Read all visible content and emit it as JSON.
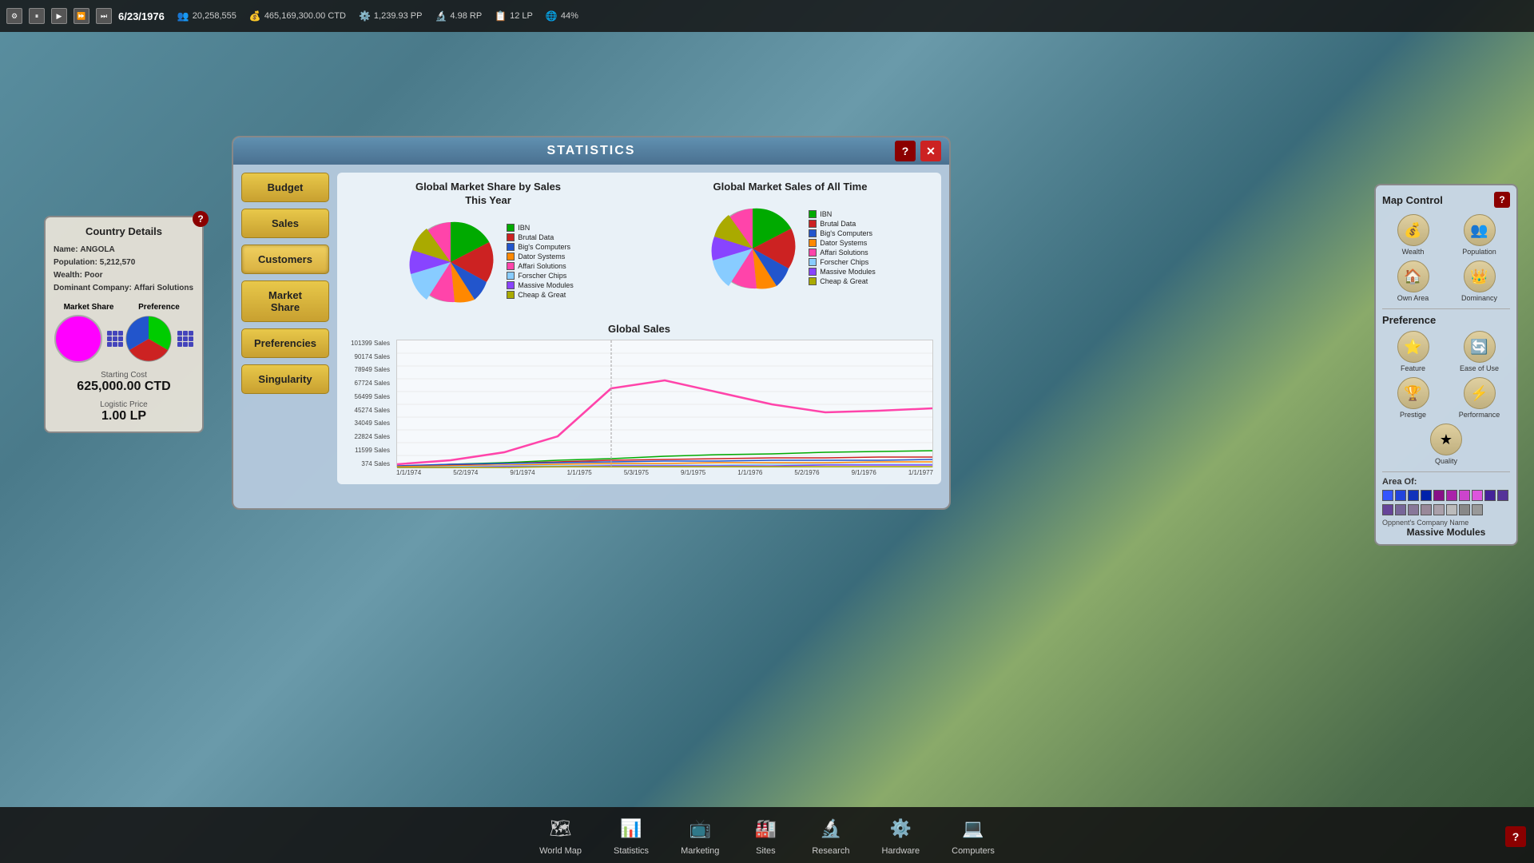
{
  "topbar": {
    "date": "6/23/1976",
    "stats": [
      {
        "icon": "👥",
        "value": "20,258,555"
      },
      {
        "icon": "💰",
        "value": "465,169,300.00 CTD"
      },
      {
        "icon": "⚙️",
        "value": "1,239.93 PP"
      },
      {
        "icon": "🔬",
        "value": "4.98 RP"
      },
      {
        "icon": "📋",
        "value": "12 LP"
      },
      {
        "icon": "🌐",
        "value": "44%"
      }
    ],
    "controls": [
      "⏸",
      "▶",
      "⏩",
      "⏩⏩"
    ]
  },
  "country_details": {
    "title": "Country Details",
    "name_label": "Name:",
    "name_value": "ANGOLA",
    "population_label": "Population:",
    "population_value": "5,212,570",
    "wealth_label": "Wealth:",
    "wealth_value": "Poor",
    "dominant_label": "Dominant Company:",
    "dominant_value": "Affari Solutions",
    "market_share_label": "Market Share",
    "preference_label": "Preference",
    "starting_cost_label": "Starting Cost",
    "starting_cost_value": "625,000.00 CTD",
    "logistic_label": "Logistic Price",
    "logistic_value": "1.00 LP"
  },
  "statistics": {
    "title": "STATISTICS",
    "nav_items": [
      "Budget",
      "Sales",
      "Customers",
      "Market Share",
      "Preferencies",
      "Singularity"
    ],
    "active_nav": "Customers",
    "chart1_title": "Global Market Share by Sales\nThis Year",
    "chart2_title": "Global Market Sales of All Time",
    "line_chart_title": "Global Sales",
    "legend_items": [
      {
        "color": "#00aa00",
        "label": "IBN"
      },
      {
        "color": "#cc2222",
        "label": "Brutal Data"
      },
      {
        "color": "#2255cc",
        "label": "Big's Computers"
      },
      {
        "color": "#ff8800",
        "label": "Dator Systems"
      },
      {
        "color": "#ff44aa",
        "label": "Affari Solutions"
      },
      {
        "color": "#88ccff",
        "label": "Forscher Chips"
      },
      {
        "color": "#8844ff",
        "label": "Massive Modules"
      },
      {
        "color": "#aaaa00",
        "label": "Cheap & Great"
      }
    ],
    "y_axis_labels": [
      "101399 Sales",
      "90174 Sales",
      "78949 Sales",
      "67724 Sales",
      "56499 Sales",
      "45274 Sales",
      "34049 Sales",
      "22824 Sales",
      "11599 Sales",
      "374 Sales"
    ],
    "x_axis_labels": [
      "1/1/1974",
      "5/2/1974",
      "9/1/1974",
      "1/1/1975",
      "5/3/1975",
      "9/1/1975",
      "1/1/1976",
      "5/2/1976",
      "9/1/1976",
      "1/1/1977"
    ]
  },
  "map_control": {
    "title": "Map Control",
    "help": "?",
    "icons": [
      {
        "icon": "💰",
        "label": "Wealth"
      },
      {
        "icon": "👥",
        "label": "Population"
      },
      {
        "icon": "🏠",
        "label": "Own Area"
      },
      {
        "icon": "👑",
        "label": "Dominancy"
      }
    ],
    "preference_title": "Preference",
    "pref_icons": [
      {
        "icon": "⭐",
        "label": "Feature"
      },
      {
        "icon": "🔄",
        "label": "Ease of Use"
      },
      {
        "icon": "🏆",
        "label": "Prestige"
      },
      {
        "icon": "⚡",
        "label": "Performance"
      },
      {
        "icon": "★",
        "label": "Quality"
      }
    ],
    "area_title": "Area Of:",
    "area_colors": [
      "#3355ff",
      "#2244dd",
      "#1133bb",
      "#0022aa",
      "#881188",
      "#aa22aa",
      "#cc44cc",
      "#dd55dd",
      "#442299",
      "#553399",
      "#664499",
      "#776699",
      "#887799",
      "#998899",
      "#aaa0aa",
      "#bbbbbb",
      "#888888",
      "#999999"
    ],
    "opponent_label": "Oppnent's Company Name",
    "company_name": "Massive Modules"
  },
  "bottom_nav": [
    {
      "icon": "🗺",
      "label": "World Map"
    },
    {
      "icon": "📊",
      "label": "Statistics"
    },
    {
      "icon": "📺",
      "label": "Marketing"
    },
    {
      "icon": "🏭",
      "label": "Sites"
    },
    {
      "icon": "🔬",
      "label": "Research"
    },
    {
      "icon": "⚙️",
      "label": "Hardware"
    },
    {
      "icon": "💻",
      "label": "Computers"
    }
  ]
}
